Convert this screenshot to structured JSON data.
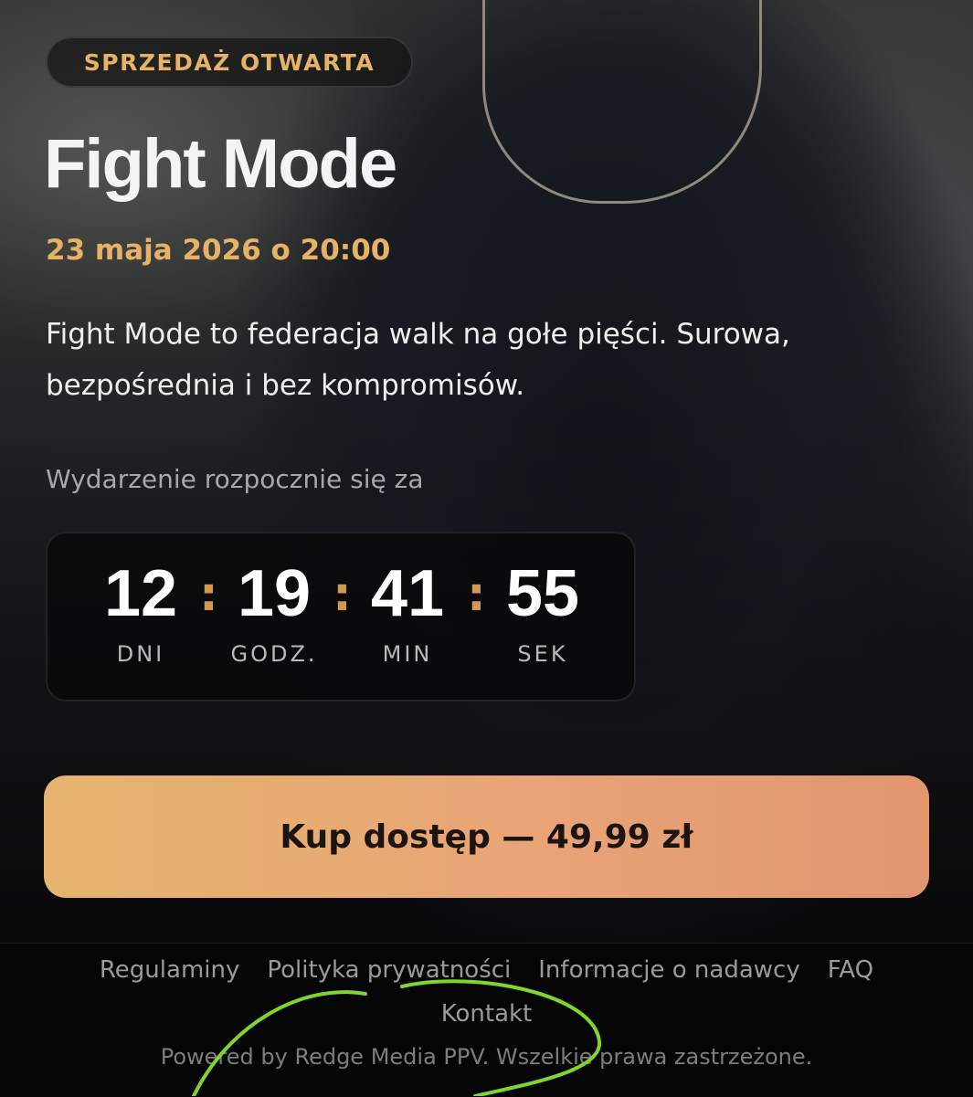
{
  "event": {
    "badge": "SPRZEDAŻ OTWARTA",
    "title": "Fight Mode",
    "date": "23 maja 2026 o 20:00",
    "description": "Fight Mode to federacja walk na gołe pięści. Surowa, bezpośrednia i bez kompromisów."
  },
  "countdown": {
    "label": "Wydarzenie rozpocznie się za",
    "units": [
      {
        "value": "12",
        "label": "DNI"
      },
      {
        "value": "19",
        "label": "GODZ."
      },
      {
        "value": "41",
        "label": "MIN"
      },
      {
        "value": "55",
        "label": "SEK"
      }
    ],
    "separator": ":"
  },
  "cta": {
    "label": "Kup dostęp — 49,99 zł"
  },
  "footer": {
    "links": [
      "Regulaminy",
      "Polityka prywatności",
      "Informacje o nadawcy",
      "FAQ"
    ],
    "contact": "Kontakt",
    "powered": "Powered by Redge Media PPV. Wszelkie prawa zastrzeżone."
  },
  "colors": {
    "accent": "#e6b265",
    "button_start": "#e6b46e",
    "button_end": "#e19670",
    "annotation_stroke": "#7ed62f"
  }
}
